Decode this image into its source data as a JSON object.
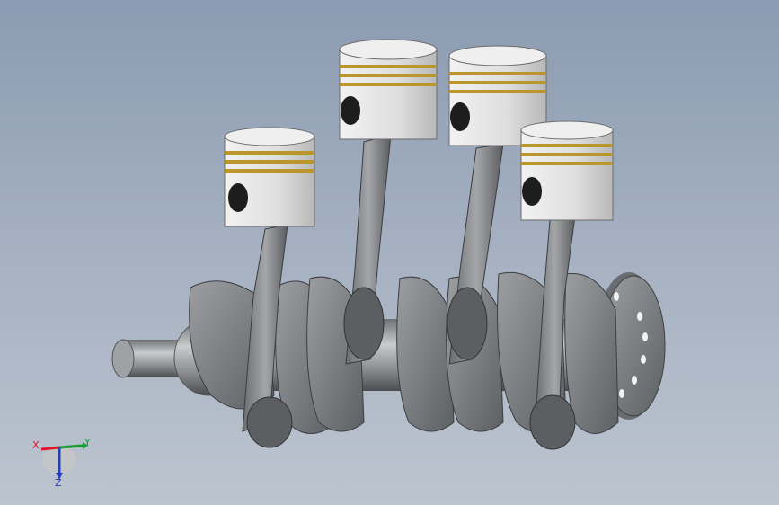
{
  "viewport": {
    "model": "crankshaft-assembly",
    "cylinders": 4,
    "colors": {
      "background_top": "#8b9bb1",
      "background_bottom": "#bcc4cf",
      "piston": "#e2e2e2",
      "piston_ring": "#b9972c",
      "steel": "#8e9092",
      "steel_dark": "#505356"
    }
  },
  "triad": {
    "x_label": "X",
    "y_label": "Y",
    "z_label": "Z",
    "colors": {
      "x": "#e0182a",
      "y": "#1a9b35",
      "z": "#2440b8"
    }
  }
}
